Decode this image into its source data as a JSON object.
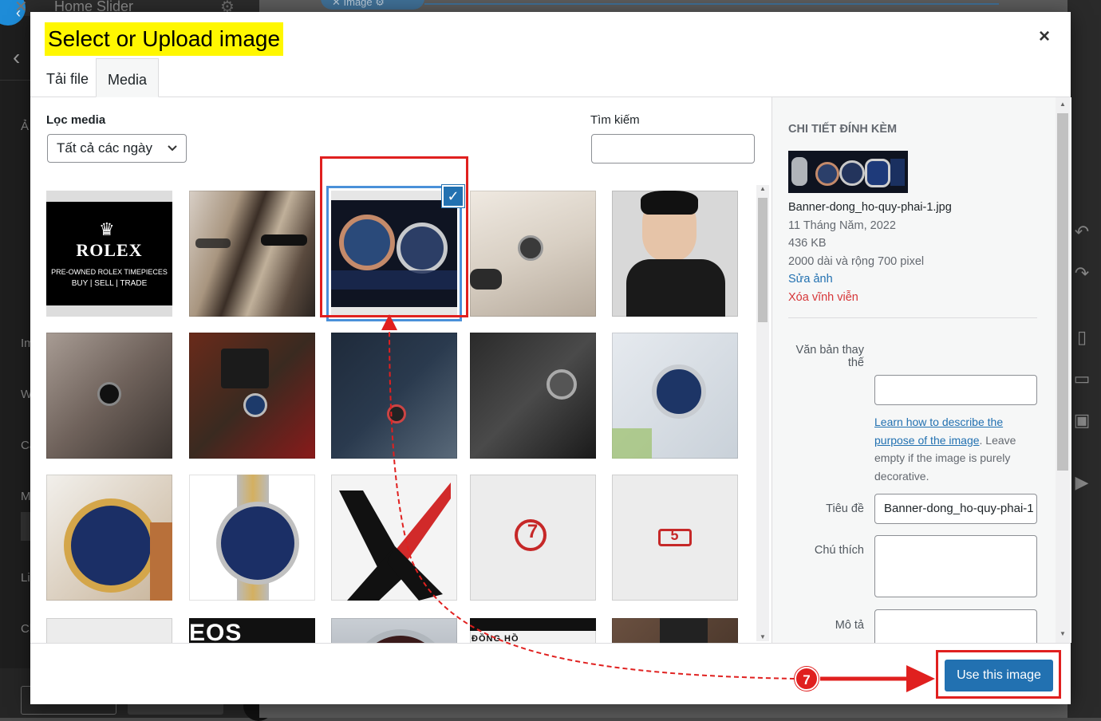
{
  "background": {
    "panel_title": "Home Slider",
    "pill_label": "Image",
    "side_fragments": [
      "Ả",
      "Im",
      "W",
      "Ca",
      "M",
      "Li",
      "Ch"
    ],
    "left_buttons": [
      "",
      ""
    ]
  },
  "modal": {
    "title": "Select or Upload image",
    "close_label": "×",
    "tabs": [
      {
        "label": "Tải file",
        "active": false
      },
      {
        "label": "Media",
        "active": true
      }
    ]
  },
  "filter": {
    "label": "Lọc media",
    "selected": "Tất cả các ngày"
  },
  "search": {
    "label": "Tìm kiếm",
    "value": "",
    "placeholder": ""
  },
  "grid": {
    "tiles": [
      {
        "text": "ROLEX",
        "sub": "PRE-OWNED ROLEX TIMEPIECES",
        "sub2": "BUY | SELL | TRADE",
        "color": "#000000"
      },
      {
        "text": "",
        "color": "#6b5a4a"
      },
      {
        "text": "",
        "color": "#141a2a",
        "selected": true
      },
      {
        "text": "",
        "color": "#d9d2c8"
      },
      {
        "text": "",
        "color": "#2b2b2b"
      },
      {
        "text": "",
        "color": "#7a6f66"
      },
      {
        "text": "",
        "color": "#5b3a2a"
      },
      {
        "text": "",
        "color": "#2a3240"
      },
      {
        "text": "",
        "color": "#3a3a3a"
      },
      {
        "text": "",
        "color": "#cfd5dc"
      },
      {
        "text": "",
        "color": "#b8b8b8"
      },
      {
        "text": "",
        "color": "#f4f4f4"
      },
      {
        "text": "",
        "color": "#eeeeee"
      },
      {
        "text": "7",
        "color": "#ececec"
      },
      {
        "text": "5",
        "color": "#ececec"
      },
      {
        "text": "",
        "color": "#ececec"
      },
      {
        "text": "EOS",
        "color": "#111111"
      },
      {
        "text": "",
        "color": "#9aa3ab"
      },
      {
        "text": "ĐỒNG HỒ",
        "color": "#f2f2f2"
      },
      {
        "text": "",
        "color": "#6a5040"
      }
    ]
  },
  "attachment": {
    "heading": "Chi tiết đính kèm",
    "filename": "Banner-dong_ho-quy-phai-1.jpg",
    "date": "11 Tháng Năm, 2022",
    "size": "436 KB",
    "dimensions": "2000 dài và rộng 700 pixel",
    "edit_link": "Sửa ảnh",
    "delete_link": "Xóa vĩnh viễn",
    "fields": {
      "alt_label_1": "Văn bản thay",
      "alt_label_2": "thế",
      "alt_value": "",
      "help_link": "Learn how to describe the purpose of the image",
      "help_rest": ". Leave empty if the image is purely decorative.",
      "title_label": "Tiêu đề",
      "title_value": "Banner-dong_ho-quy-phai-1",
      "caption_label": "Chú thích",
      "caption_value": "",
      "desc_label": "Mô tả",
      "desc_value": ""
    }
  },
  "footer": {
    "use_button": "Use this image"
  },
  "annotation": {
    "step": "7",
    "color": "#e0201f"
  },
  "colors": {
    "primary": "#2271b1",
    "danger": "#d63638",
    "highlight": "#fff700"
  }
}
